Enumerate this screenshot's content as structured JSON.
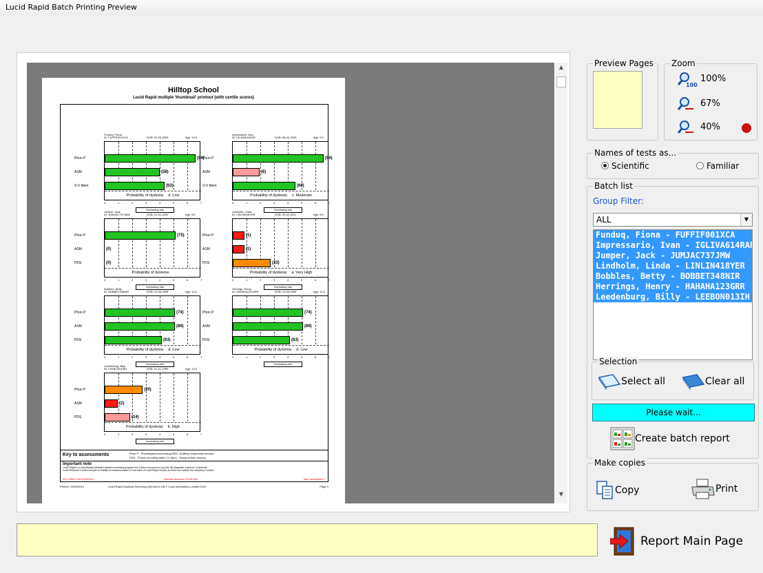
{
  "window": {
    "title": "Lucid Rapid Batch Printing Preview"
  },
  "preview": {
    "school": "Hilltop School",
    "subtitle": "Lucid Rapid multiple 'thumbnail' printout (with centile scores)",
    "scale_ticks": [
      "0",
      "1",
      "2",
      "3",
      "4",
      "5",
      "6",
      "7"
    ],
    "arrow_label": "Increasing risk",
    "thumbnails": [
      {
        "name": "Funduq, Fiona",
        "id": "ID: FUFFIF001XCA",
        "dob": "DOB: 01-03-2003",
        "age": "Age: 10:0",
        "rows": [
          {
            "label": "Phon P",
            "value": 96,
            "color": "#22c322",
            "text": "(96)"
          },
          {
            "label": "ASM",
            "value": 58,
            "color": "#22c322",
            "text": "(58)"
          },
          {
            "label": "V-V Mem",
            "value": 63,
            "color": "#22c322",
            "text": "(63)"
          }
        ],
        "prob_label": "Probability of dyslexia:",
        "prob_value": "d. Low"
      },
      {
        "name": "Impressario, Ivan",
        "id": "ID: IGLIVA614RAR",
        "dob": "DOB: 08-04-2003",
        "age": "Age: 9:9",
        "rows": [
          {
            "label": "Phon P",
            "value": 96,
            "color": "#22c322",
            "text": "(96)"
          },
          {
            "label": "ASM",
            "value": 28,
            "color": "#ff9b9b",
            "text": "(6)"
          },
          {
            "label": "V-V Mem",
            "value": 66,
            "color": "#22c322",
            "text": "(66)"
          }
        ],
        "prob_label": "Probability of dyslexia:",
        "prob_value": "c. Moderate"
      },
      {
        "name": "Jumper, Jack",
        "id": "ID: JUMJAC737JMW",
        "dob": "DOB: 01-01-2002",
        "age": "Age: 8:1",
        "rows": [
          {
            "label": "Phon P",
            "value": 75,
            "color": "#22c322",
            "text": "(75)"
          },
          {
            "label": "ASM",
            "value": 0,
            "color": "#22c322",
            "text": "(0)"
          },
          {
            "label": "PDS",
            "value": 0,
            "color": "#22c322",
            "text": "(0)"
          }
        ],
        "prob_label": "Probability of dyslexia:",
        "prob_value": ""
      },
      {
        "name": "Lindholm, Linda",
        "id": "ID: LINLIN418YER",
        "dob": "DOB: 20-02-2001",
        "age": "Age: 8:9",
        "rows": [
          {
            "label": "Phon P",
            "value": 12,
            "color": "#ff1a1a",
            "text": "(1)"
          },
          {
            "label": "ASM",
            "value": 12,
            "color": "#ff1a1a",
            "text": "(1)"
          },
          {
            "label": "PDS",
            "value": 40,
            "color": "#ff8a00",
            "text": "(33)"
          }
        ],
        "prob_label": "Probability of dyslexia:",
        "prob_value": "a. Very High"
      },
      {
        "name": "Bobbles, Betty",
        "id": "ID: BOBBET348NIR",
        "dob": "DOB: 12-06-1999",
        "age": "Age: 11:0",
        "rows": [
          {
            "label": "Phon P",
            "value": 74,
            "color": "#22c322",
            "text": "(74)"
          },
          {
            "label": "ASM",
            "value": 74,
            "color": "#22c322",
            "text": "(89)"
          },
          {
            "label": "PDS",
            "value": 60,
            "color": "#22c322",
            "text": "(63)"
          }
        ],
        "prob_label": "Probability of dyslexia:",
        "prob_value": "d. Low"
      },
      {
        "name": "Herrings, Henry",
        "id": "ID: HAHAHA123GRR",
        "dob": "DOB: 12-05-1999",
        "age": "Age: 11:0",
        "rows": [
          {
            "label": "Phon P",
            "value": 74,
            "color": "#22c322",
            "text": "(74)"
          },
          {
            "label": "ASM",
            "value": 74,
            "color": "#22c322",
            "text": "(89)"
          },
          {
            "label": "PDS",
            "value": 60,
            "color": "#22c322",
            "text": "(63)"
          }
        ],
        "prob_label": "Probability of dyslexia:",
        "prob_value": "d. Low"
      },
      {
        "name": "Leedenburg, Billy",
        "id": "ID: LEEBON013IH",
        "dob": "DOB: 01-01-1999",
        "age": "Age: 12:0",
        "rows": [
          {
            "label": "Phon P",
            "value": 40,
            "color": "#ff8a00",
            "text": "(20)"
          },
          {
            "label": "ASM",
            "value": 14,
            "color": "#ff1a1a",
            "text": "(2)"
          },
          {
            "label": "PDS",
            "value": 27,
            "color": "#ff9b9b",
            "text": "(14)"
          }
        ],
        "prob_label": "Probability of dyslexia:",
        "prob_value": "b. High"
      }
    ],
    "key_title": "Key to assessments",
    "key_line1": "Phon P - Phonological processing   ASM - Auditory sequential memory",
    "key_line2": "PDS - Phonic decoding skills   V-V Mem - Visual-verbal memory",
    "note_title": "Important note",
    "note_line1": "Lucid Rapid is a scientifically validated dyslexia screening program but it does not purport to provide full diagnostic evidence of dyslexia.",
    "note_line2": "Lucid Research Limited accepts no liability for decisions taken on the basis of Lucid Rapid results, as these are outside the company's control.",
    "serial": "S/N: 04562-7204-JKM10100",
    "shutdown": "Software shutdown: 15-08-2011",
    "workstations": "Max. workstations: 1",
    "printed": "Printed: 19/02/2010",
    "software": "Lucid Rapid Dyslexia Screening [Version 6.04]  © Lucid Innovations Limited 2010",
    "page_no": "Page 1"
  },
  "preview_pages": {
    "label": "Preview Pages"
  },
  "zoom": {
    "label": "Zoom",
    "levels": [
      "100%",
      "67%",
      "40%"
    ],
    "active_color": "#cc1111"
  },
  "names": {
    "label": "Names of tests as...",
    "options": [
      "Scientific",
      "Familiar"
    ],
    "selected": "Scientific"
  },
  "batch": {
    "label": "Batch list",
    "filter_label": "Group Filter:",
    "filter_value": "ALL",
    "students": [
      "Funduq, Fiona - FUFFIF001XCA",
      "Impressario, Ivan - IGLIVA614RAR",
      "Jumper, Jack - JUMJAC737JMW",
      "Lindholm, Linda - LINLIN418YER",
      "Bobbles, Betty - BOBBET348NIR",
      "Herrings, Henry - HAHAHA123GRR",
      "Leedenburg, Billy - LEEBON013IH"
    ]
  },
  "selection": {
    "label": "Selection",
    "select_all": "Select all",
    "clear_all": "Clear all"
  },
  "status_text": "Please wait...",
  "create_report": "Create batch report",
  "copies": {
    "label": "Make copies",
    "copy": "Copy",
    "print": "Print"
  },
  "report_main": "Report Main Page"
}
